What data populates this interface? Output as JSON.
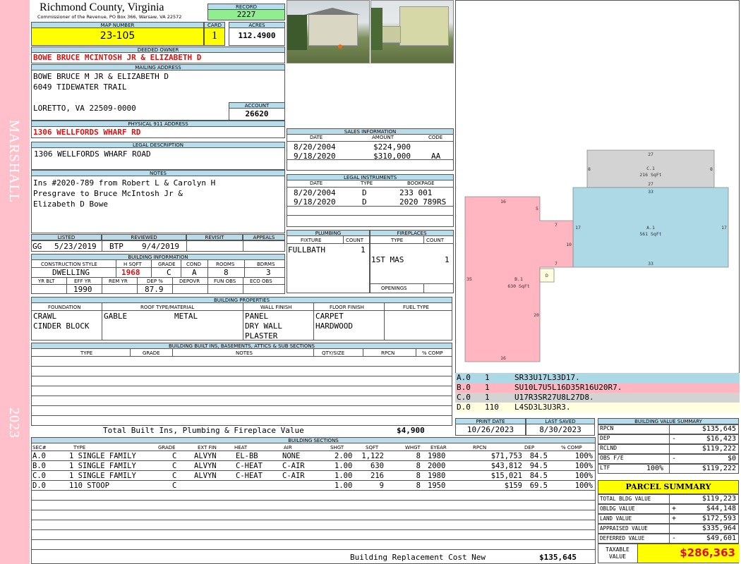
{
  "sidebar": {
    "district": "MARSHALL",
    "year": "2023"
  },
  "header": {
    "county": "Richmond County, Virginia",
    "commissioner": "Commissioner of the Revenue, PO Box 366, Warsaw, VA 22572",
    "record_label": "RECORD",
    "record": "2227",
    "map_label": "MAP NUMBER",
    "map_number": "23-105",
    "card_label": "CARD",
    "card": "1",
    "acres_label": "ACRES",
    "acres": "112.4900"
  },
  "owner": {
    "deeded_label": "DEEDED OWNER",
    "deeded": "BOWE BRUCE MCINTOSH JR & ELIZABETH D",
    "mailing_label": "MAILING ADDRESS",
    "mailing_lines": [
      "BOWE BRUCE M JR & ELIZABETH D",
      "6049 TIDEWATER TRAIL",
      "",
      "LORETTO, VA 22509-0000"
    ],
    "account_label": "ACCOUNT",
    "account": "26620",
    "physical_label": "PHYSICAL 911 ADDRESS",
    "physical": "1306 WELLFORDS WHARF RD",
    "legal_label": "LEGAL DESCRIPTION",
    "legal": "1306 WELLFORDS WHARF ROAD",
    "notes_label": "NOTES",
    "notes_lines": [
      "Ins #2020-789 from Robert L & Carolyn H",
      "Presgrave to Bruce McIntosh Jr &",
      "Elizabeth D Bowe"
    ]
  },
  "sales": {
    "title": "SALES INFORMATION",
    "cols": [
      "DATE",
      "AMOUNT",
      "CODE"
    ],
    "rows": [
      [
        "8/20/2004",
        "$224,900",
        ""
      ],
      [
        "9/18/2020",
        "$310,000",
        "AA"
      ]
    ]
  },
  "legal_instruments": {
    "title": "LEGAL INSTRUMENTS",
    "cols": [
      "DATE",
      "TYPE",
      "BOOKPAGE"
    ],
    "rows": [
      [
        "8/20/2004",
        "D",
        "233 001"
      ],
      [
        "9/18/2020",
        "D",
        "2020 789RS"
      ]
    ]
  },
  "review": {
    "listed_label": "LISTED",
    "reviewed_label": "REVIEWED",
    "revisit_label": "REVISIT",
    "appeals_label": "APPEALS",
    "listed_by": "GG",
    "listed_date": "5/23/2019",
    "reviewed_by": "BTP",
    "reviewed_date": "9/4/2019"
  },
  "building_info": {
    "title": "BUILDING INFORMATION",
    "cols": [
      "CONSTRUCTION STYLE",
      "H SQFT",
      "GRADE",
      "COND",
      "ROOMS",
      "BDRMS"
    ],
    "values": [
      "DWELLING",
      "1968",
      "C",
      "A",
      "8",
      "3"
    ],
    "cols2": [
      "YR BLT",
      "EFF YR",
      "REM YR",
      "DEP %",
      "DEPOVR",
      "FUN OBS",
      "ECO OBS"
    ],
    "values2": [
      "",
      "1990",
      "",
      "87.9",
      "",
      "",
      ""
    ]
  },
  "plumbing": {
    "title": "PLUMBING",
    "cols": [
      "FIXTURE",
      "COUNT"
    ],
    "rows": [
      [
        "FULLBATH",
        "1"
      ]
    ]
  },
  "fireplaces": {
    "title": "FIREPLACES",
    "cols": [
      "TYPE",
      "COUNT"
    ],
    "rows": [
      [
        "1ST MAS",
        "1"
      ]
    ],
    "openings_label": "OPENINGS"
  },
  "properties": {
    "title": "BUILDING PROPERTIES",
    "cols": [
      "FOUNDATION",
      "ROOF TYPE/MATERIAL",
      "WALL FINISH",
      "FLOOR FINISH",
      "FUEL TYPE"
    ],
    "foundation": [
      "CRAWL",
      "CINDER BLOCK"
    ],
    "roof_type": "GABLE",
    "roof_material": "METAL",
    "wall": [
      "PANEL",
      "DRY WALL",
      "PLASTER"
    ],
    "floor": [
      "CARPET",
      "HARDWOOD"
    ]
  },
  "builtins": {
    "title": "BUILDING BUILT INS, BASEMENTS, ATTICS & SUB SECTIONS",
    "cols": [
      "TYPE",
      "GRADE",
      "NOTES",
      "QTY/SIZE",
      "RPCN",
      "% COMP"
    ],
    "total_label": "Total Built Ins, Plumbing & Fireplace Value",
    "total": "$4,900"
  },
  "sections": {
    "title": "BUILDING SECTIONS",
    "cols": [
      "SEC#",
      "TYPE",
      "GRADE",
      "EXT FIN",
      "HEAT",
      "AIR",
      "SHGT",
      "SQFT",
      "WHGT",
      "EYEAR",
      "RPCN",
      "DEP",
      "% COMP"
    ],
    "rows": [
      [
        "A.0",
        "1 SINGLE FAMILY",
        "C",
        "ALVYN",
        "EL-BB",
        "NONE",
        "2.00",
        "1,122",
        "8",
        "1980",
        "$71,753",
        "84.5",
        "100%"
      ],
      [
        "B.0",
        "1 SINGLE FAMILY",
        "C",
        "ALVYN",
        "C-HEAT",
        "C-AIR",
        "1.00",
        "630",
        "8",
        "2000",
        "$43,812",
        "94.5",
        "100%"
      ],
      [
        "C.0",
        "1 SINGLE FAMILY",
        "C",
        "ALVYN",
        "C-HEAT",
        "C-AIR",
        "1.00",
        "216",
        "8",
        "1980",
        "$15,021",
        "84.5",
        "100%"
      ],
      [
        "D.0",
        "110 STOOP",
        "C",
        "",
        "",
        "",
        "1.00",
        "9",
        "8",
        "1950",
        "$159",
        "69.5",
        "100%"
      ]
    ],
    "replacement_label": "Building Replacement Cost New",
    "replacement": "$135,645"
  },
  "sketch": {
    "labels": [
      {
        "id": "A.1",
        "area": "561 SqFt"
      },
      {
        "id": "B.1",
        "area": "630 SqFt"
      },
      {
        "id": "C.1",
        "area": "216 SqFt"
      },
      {
        "id": "D",
        "area": ""
      }
    ],
    "dims": [
      "27",
      "8",
      "8",
      "27",
      "33",
      "17",
      "17",
      "33",
      "16",
      "5",
      "7",
      "10",
      "7",
      "35",
      "20",
      "16"
    ],
    "colors": {
      "A": "#add8e6",
      "B": "#ffb6c1",
      "C": "#d3d3d3",
      "D": "#ffffe0"
    }
  },
  "vectors": [
    {
      "sec": "A.0",
      "n": "1",
      "code": "SR33U17L33D17."
    },
    {
      "sec": "B.0",
      "n": "1",
      "code": "SU10L7U5L16D35R16U20R7."
    },
    {
      "sec": "C.0",
      "n": "1",
      "code": "U17R3SR27U8L27D8."
    },
    {
      "sec": "D.0",
      "n": "110",
      "code": "L4SD3L3U3R3."
    }
  ],
  "dates": {
    "print_label": "PRINT DATE",
    "print": "10/26/2023",
    "saved_label": "LAST SAVED",
    "saved": "8/30/2023"
  },
  "value_summary": {
    "title": "BUILDING VALUE SUMMARY",
    "rows": [
      {
        "label": "RPCN",
        "sign": "",
        "extra": "",
        "value": "$135,645"
      },
      {
        "label": "DEP",
        "sign": "-",
        "extra": "",
        "value": "$16,423"
      },
      {
        "label": "RCLND",
        "sign": "",
        "extra": "",
        "value": "$119,222"
      },
      {
        "label": "OBS F/E",
        "sign": "-",
        "extra": "",
        "value": "$0"
      },
      {
        "label": "LTF",
        "sign": "",
        "extra": "100%",
        "value": "$119,222"
      }
    ]
  },
  "parcel": {
    "title": "PARCEL SUMMARY",
    "rows": [
      {
        "label": "TOTAL BLDG VALUE",
        "sign": "",
        "value": "$119,223"
      },
      {
        "label": "OBLDG VALUE",
        "sign": "+",
        "value": "$44,148"
      },
      {
        "label": "LAND VALUE",
        "sign": "+",
        "value": "$172,593"
      },
      {
        "label": "APPRAISED VALUE",
        "sign": "",
        "value": "$335,964"
      },
      {
        "label": "DEFERRED VALUE",
        "sign": "-",
        "value": "$49,601"
      }
    ],
    "taxable_label": "TAXABLE VALUE",
    "taxable": "$286,363"
  }
}
